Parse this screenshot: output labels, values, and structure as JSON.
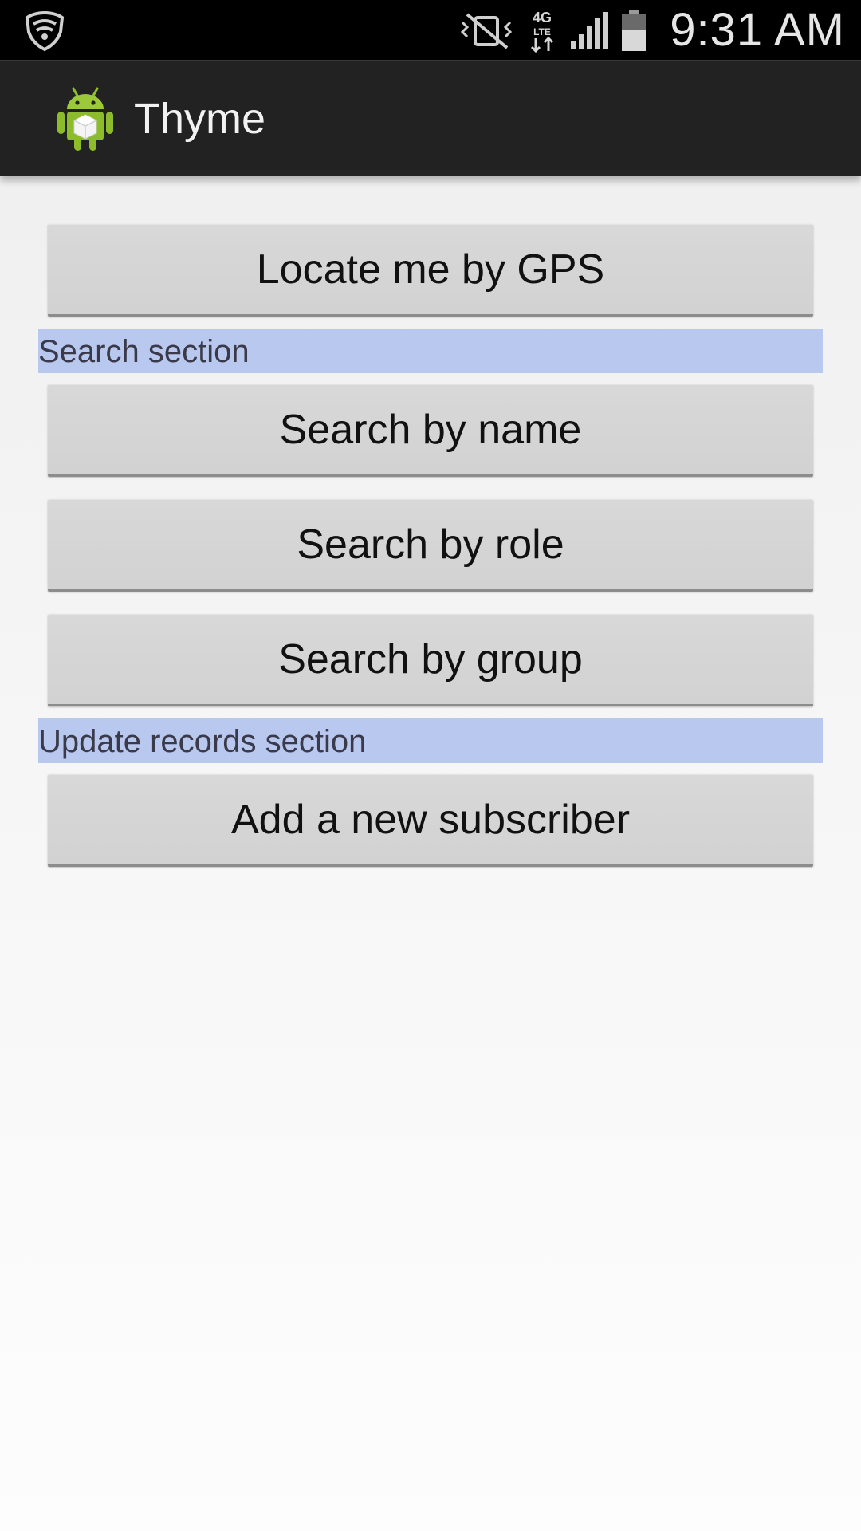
{
  "status_bar": {
    "time": "9:31 AM",
    "icons": [
      "shield-icon",
      "vibrate-mute-icon",
      "4g-lte-icon",
      "signal-icon",
      "battery-icon"
    ],
    "network_label": "4G",
    "network_sub": "LTE"
  },
  "action_bar": {
    "title": "Thyme",
    "icon": "android-app-icon"
  },
  "buttons": {
    "locate_gps": "Locate me by GPS",
    "search_name": "Search by name",
    "search_role": "Search by role",
    "search_group": "Search by group",
    "add_subscriber": "Add a new subscriber"
  },
  "sections": {
    "search": "Search section",
    "update": "Update records section"
  },
  "colors": {
    "status_bar_bg": "#000000",
    "action_bar_bg": "#222222",
    "section_header_bg": "#b9c8ee",
    "button_bg": "#d4d4d4"
  }
}
